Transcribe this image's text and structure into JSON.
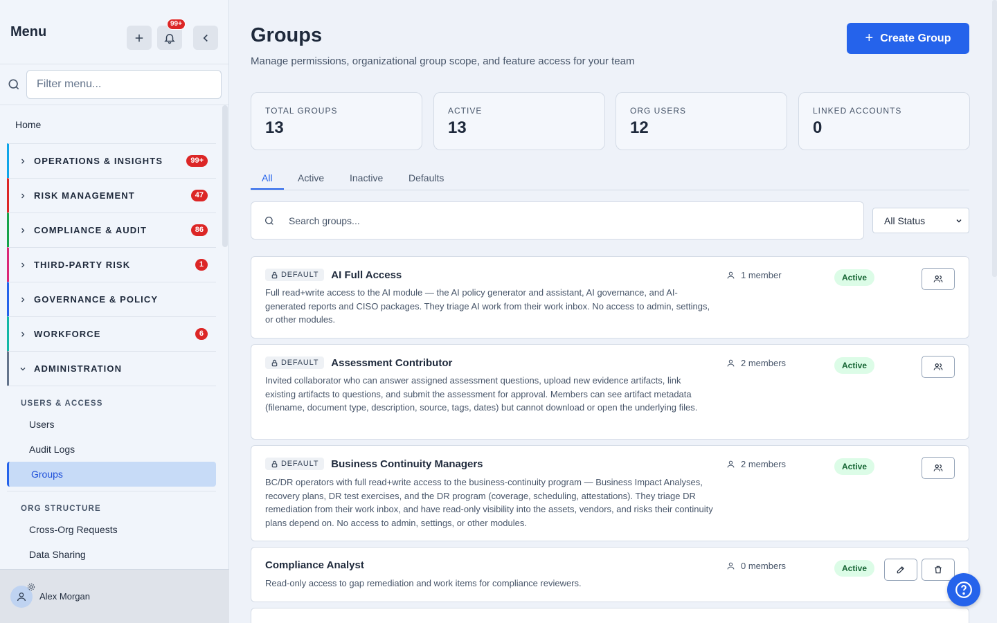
{
  "sidebar": {
    "title": "Menu",
    "notif_count": "99+",
    "filter_placeholder": "Filter menu...",
    "home": "Home",
    "sections": [
      {
        "label": "OPERATIONS & INSIGHTS",
        "badge": "99+",
        "color": "#0ea5e9"
      },
      {
        "label": "RISK MANAGEMENT",
        "badge": "47",
        "color": "#dc2626"
      },
      {
        "label": "COMPLIANCE & AUDIT",
        "badge": "86",
        "color": "#16a34a"
      },
      {
        "label": "THIRD-PARTY RISK",
        "badge": "1",
        "color": "#db2777"
      },
      {
        "label": "GOVERNANCE & POLICY",
        "badge": "",
        "color": "#2563eb"
      },
      {
        "label": "WORKFORCE",
        "badge": "6",
        "color": "#14b8a6"
      },
      {
        "label": "ADMINISTRATION",
        "badge": "",
        "color": "#64748b"
      }
    ],
    "users_access_heading": "USERS & ACCESS",
    "users_access_items": [
      "Users",
      "Audit Logs",
      "Groups"
    ],
    "org_structure_heading": "ORG STRUCTURE",
    "org_structure_items": [
      "Cross-Org Requests",
      "Data Sharing"
    ],
    "user_name": "Alex Morgan"
  },
  "header": {
    "title": "Groups",
    "subtitle": "Manage permissions, organizational group scope, and feature access for your team",
    "create_label": "Create Group"
  },
  "stats": [
    {
      "label": "TOTAL GROUPS",
      "value": "13"
    },
    {
      "label": "ACTIVE",
      "value": "13"
    },
    {
      "label": "ORG USERS",
      "value": "12"
    },
    {
      "label": "LINKED ACCOUNTS",
      "value": "0"
    }
  ],
  "tabs": [
    "All",
    "Active",
    "Inactive",
    "Defaults"
  ],
  "search_placeholder": "Search groups...",
  "status_filter": "All Status",
  "default_badge": "DEFAULT",
  "active_label": "Active",
  "groups": [
    {
      "name": "AI Full Access",
      "members": "1 member",
      "desc": "Full read+write access to the AI module — the AI policy generator and assistant, AI governance, and AI-generated reports and CISO packages. They triage AI work from their work inbox. No access to admin, settings, or other modules."
    },
    {
      "name": "Assessment Contributor",
      "members": "2 members",
      "desc": "Invited collaborator who can answer assigned assessment questions, upload new evidence artifacts, link existing artifacts to questions, and submit the assessment for approval. Members can see artifact metadata (filename, document type, description, source, tags, dates) but cannot download or open the underlying files."
    },
    {
      "name": "Business Continuity Managers",
      "members": "2 members",
      "desc": "BC/DR operators with full read+write access to the business-continuity program — Business Impact Analyses, recovery plans, DR test exercises, and the DR program (coverage, scheduling, attestations). They triage DR remediation from their work inbox, and have read-only visibility into the assets, vendors, and risks their continuity plans depend on. No access to admin, settings, or other modules."
    },
    {
      "name": "Compliance Analyst",
      "members": "0 members",
      "desc": "Read-only access to gap remediation and work items for compliance reviewers."
    }
  ]
}
